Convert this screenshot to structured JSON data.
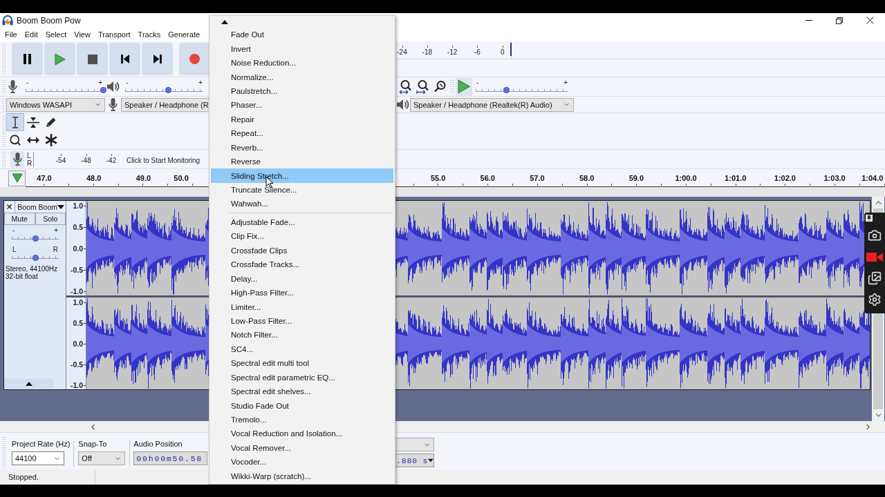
{
  "window": {
    "title": "Boom Boom Pow"
  },
  "menu_bar": [
    "File",
    "Edit",
    "Select",
    "View",
    "Transport",
    "Tracks",
    "Generate"
  ],
  "playback_meter": {
    "ticks": [
      "-24",
      "-18",
      "-12",
      "-6",
      "0"
    ]
  },
  "mixer": {
    "recording_volume": {
      "min_label": "-",
      "max_label": "+",
      "level": 1
    },
    "playback_volume": {
      "min_label": "-",
      "max_label": "+",
      "level": 0.55
    }
  },
  "play_at_speed": {
    "min_label": "-",
    "max_label": "+",
    "level": 0.33
  },
  "devices": {
    "host": "Windows WASAPI",
    "recording_device": "Speaker / Headphone (R",
    "playback_device": "Speaker / Headphone (Realtek(R) Audio)"
  },
  "tools": [
    {
      "kind": "select",
      "selected": true
    },
    {
      "kind": "envelope",
      "selected": false
    },
    {
      "kind": "draw",
      "selected": false
    },
    {
      "kind": "zoom",
      "selected": false
    },
    {
      "kind": "time_shift",
      "selected": false
    },
    {
      "kind": "multi",
      "selected": false
    }
  ],
  "recording_meter": {
    "channels": [
      "L",
      "R"
    ],
    "ticks": [
      "-54",
      "-48",
      "-42"
    ],
    "hint": "Click to Start Monitoring"
  },
  "timeline": {
    "left_ticks": [
      "47.0",
      "48.0",
      "49.0",
      "50.0"
    ],
    "right_ticks": [
      "55.0",
      "56.0",
      "57.0",
      "58.0",
      "59.0",
      "1:00.0",
      "1:01.0",
      "1:02.0",
      "1:03.0",
      "1:04.0"
    ]
  },
  "track": {
    "name": "Boom Boom",
    "buttons": [
      "Mute",
      "Solo"
    ],
    "gain": {
      "min_label": "-",
      "max_label": "+",
      "level": 0.5
    },
    "pan": {
      "min_label": "L",
      "max_label": "R",
      "level": 0.5
    },
    "info": [
      "Stereo, 44100Hz",
      "32-bit float"
    ],
    "channels": [
      {
        "scale": [
          "1.0",
          "0.5",
          "0.0",
          "-0.5",
          "-1.0"
        ]
      },
      {
        "scale": [
          "1.0",
          "0.5",
          "0.0",
          "-0.5",
          "-1.0"
        ]
      }
    ]
  },
  "effect_menu": {
    "sections": [
      {
        "items": [
          {
            "label": "Fade Out",
            "selected": false
          },
          {
            "label": "Invert",
            "selected": false
          },
          {
            "label": "Noise Reduction...",
            "selected": false
          },
          {
            "label": "Normalize...",
            "selected": false
          },
          {
            "label": "Paulstretch...",
            "selected": false
          },
          {
            "label": "Phaser...",
            "selected": false
          },
          {
            "label": "Repair",
            "selected": false
          },
          {
            "label": "Repeat...",
            "selected": false
          },
          {
            "label": "Reverb...",
            "selected": false
          },
          {
            "label": "Reverse",
            "selected": false
          },
          {
            "label": "Sliding Stretch...",
            "selected": true
          },
          {
            "label": "Truncate Silence...",
            "selected": false
          },
          {
            "label": "Wahwah...",
            "selected": false
          }
        ]
      },
      {
        "items": [
          {
            "label": "Adjustable Fade...",
            "selected": false
          },
          {
            "label": "Clip Fix...",
            "selected": false
          },
          {
            "label": "Crossfade Clips",
            "selected": false
          },
          {
            "label": "Crossfade Tracks...",
            "selected": false
          },
          {
            "label": "Delay...",
            "selected": false
          },
          {
            "label": "High-Pass Filter...",
            "selected": false
          },
          {
            "label": "Limiter...",
            "selected": false
          },
          {
            "label": "Low-Pass Filter...",
            "selected": false
          },
          {
            "label": "Notch Filter...",
            "selected": false
          },
          {
            "label": "SC4...",
            "selected": false
          },
          {
            "label": "Spectral edit multi tool",
            "selected": false
          },
          {
            "label": "Spectral edit parametric EQ...",
            "selected": false
          },
          {
            "label": "Spectral edit shelves...",
            "selected": false
          },
          {
            "label": "Studio Fade Out",
            "selected": false
          },
          {
            "label": "Tremolo...",
            "selected": false
          },
          {
            "label": "Vocal Reduction and Isolation...",
            "selected": false
          },
          {
            "label": "Vocal Remover...",
            "selected": false
          },
          {
            "label": "Vocoder...",
            "selected": false
          },
          {
            "label": "Wikki-Warp (scratch)...",
            "selected": false
          }
        ]
      }
    ]
  },
  "selection_toolbar": {
    "project_rate": {
      "label": "Project Rate (Hz)",
      "value": "44100"
    },
    "snap_to": {
      "label": "Snap-To",
      "value": "Off"
    },
    "audio_position": {
      "label": "Audio Position",
      "value": "00h00m50.58"
    },
    "selection_time": {
      "value": ".880 s"
    }
  },
  "status_bar": {
    "text": "Stopped."
  }
}
